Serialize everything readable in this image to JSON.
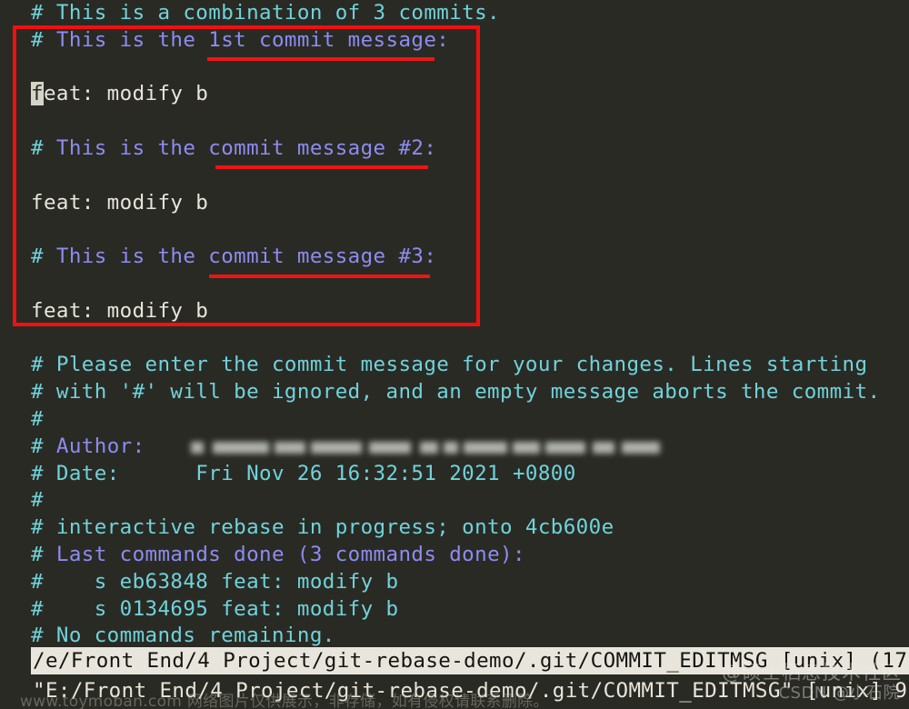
{
  "terminal": {
    "background": "#2a2a24",
    "cyan": "#6fd3db",
    "purple": "#8c8cf2",
    "white": "#e8e6dc",
    "annotation_red": "#ee1414"
  },
  "editor": {
    "lines": [
      {
        "id": "l1",
        "segments": [
          {
            "text": "# This is a combination of 3 commits.",
            "color": "cyan"
          }
        ]
      },
      {
        "id": "l2",
        "segments": [
          {
            "text": "# ",
            "color": "cyan"
          },
          {
            "text": "This is the 1st commit message:",
            "color": "purple"
          }
        ]
      },
      {
        "id": "l3",
        "segments": [
          {
            "text": "",
            "color": "cyan"
          }
        ]
      },
      {
        "id": "l4",
        "segments": [
          {
            "text": "f",
            "color": "cursor"
          },
          {
            "text": "eat: modify b",
            "color": "white"
          }
        ]
      },
      {
        "id": "l5",
        "segments": [
          {
            "text": "",
            "color": "cyan"
          }
        ]
      },
      {
        "id": "l6",
        "segments": [
          {
            "text": "# ",
            "color": "cyan"
          },
          {
            "text": "This is the commit message #2:",
            "color": "purple"
          }
        ]
      },
      {
        "id": "l7",
        "segments": [
          {
            "text": "",
            "color": "cyan"
          }
        ]
      },
      {
        "id": "l8",
        "segments": [
          {
            "text": "feat: modify b",
            "color": "white"
          }
        ]
      },
      {
        "id": "l9",
        "segments": [
          {
            "text": "",
            "color": "cyan"
          }
        ]
      },
      {
        "id": "l10",
        "segments": [
          {
            "text": "# ",
            "color": "cyan"
          },
          {
            "text": "This is the commit message #3:",
            "color": "purple"
          }
        ]
      },
      {
        "id": "l11",
        "segments": [
          {
            "text": "",
            "color": "cyan"
          }
        ]
      },
      {
        "id": "l12",
        "segments": [
          {
            "text": "feat: modify b",
            "color": "white"
          }
        ]
      },
      {
        "id": "l13",
        "segments": [
          {
            "text": "",
            "color": "cyan"
          }
        ]
      },
      {
        "id": "l14",
        "segments": [
          {
            "text": "# Please enter the commit message for your changes. Lines starting",
            "color": "cyan"
          }
        ]
      },
      {
        "id": "l15",
        "segments": [
          {
            "text": "# with '#' will be ignored, and an empty message aborts the commit.",
            "color": "cyan"
          }
        ]
      },
      {
        "id": "l16",
        "segments": [
          {
            "text": "#",
            "color": "cyan"
          }
        ]
      },
      {
        "id": "l17",
        "segments": [
          {
            "text": "# ",
            "color": "cyan"
          },
          {
            "text": "Author:",
            "color": "purple"
          },
          {
            "text": "    ",
            "color": "cyan"
          }
        ]
      },
      {
        "id": "l18",
        "segments": [
          {
            "text": "# Date:      Fri Nov 26 16:32:51 2021 +0800",
            "color": "cyan"
          }
        ]
      },
      {
        "id": "l19",
        "segments": [
          {
            "text": "#",
            "color": "cyan"
          }
        ]
      },
      {
        "id": "l20",
        "segments": [
          {
            "text": "# interactive rebase in progress; onto 4cb600e",
            "color": "cyan"
          }
        ]
      },
      {
        "id": "l21",
        "segments": [
          {
            "text": "# ",
            "color": "cyan"
          },
          {
            "text": "Last commands done (3 commands done):",
            "color": "purple"
          }
        ]
      },
      {
        "id": "l22",
        "segments": [
          {
            "text": "#    s eb63848 feat: modify b",
            "color": "cyan"
          }
        ]
      },
      {
        "id": "l23",
        "segments": [
          {
            "text": "#    s 0134695 feat: modify b",
            "color": "cyan"
          }
        ]
      },
      {
        "id": "l24",
        "segments": [
          {
            "text": "# No commands remaining.",
            "color": "cyan"
          }
        ]
      }
    ]
  },
  "annotations": {
    "box_label": "red-highlight-box",
    "underlines": [
      {
        "id": "u1",
        "label": "1st commit message:"
      },
      {
        "id": "u2",
        "label": "commit message #2:"
      },
      {
        "id": "u3",
        "label": "commit message #3:"
      }
    ]
  },
  "status": {
    "file_line": "/e/Front End/4 Project/git-rebase-demo/.git/COMMIT_EDITMSG [unix] (17:",
    "command_line": "\"E:/Front End/4 Project/git-rebase-demo/.git/COMMIT_EDITMSG\" [unix] 9"
  },
  "watermarks": {
    "csdn_big": "@硕士栖息技术社区",
    "csdn_small": "CSDN @小石院",
    "bottom": "www.toymoban.com 网络图片仅供展示，非存储，如有侵权请联系删除。"
  }
}
